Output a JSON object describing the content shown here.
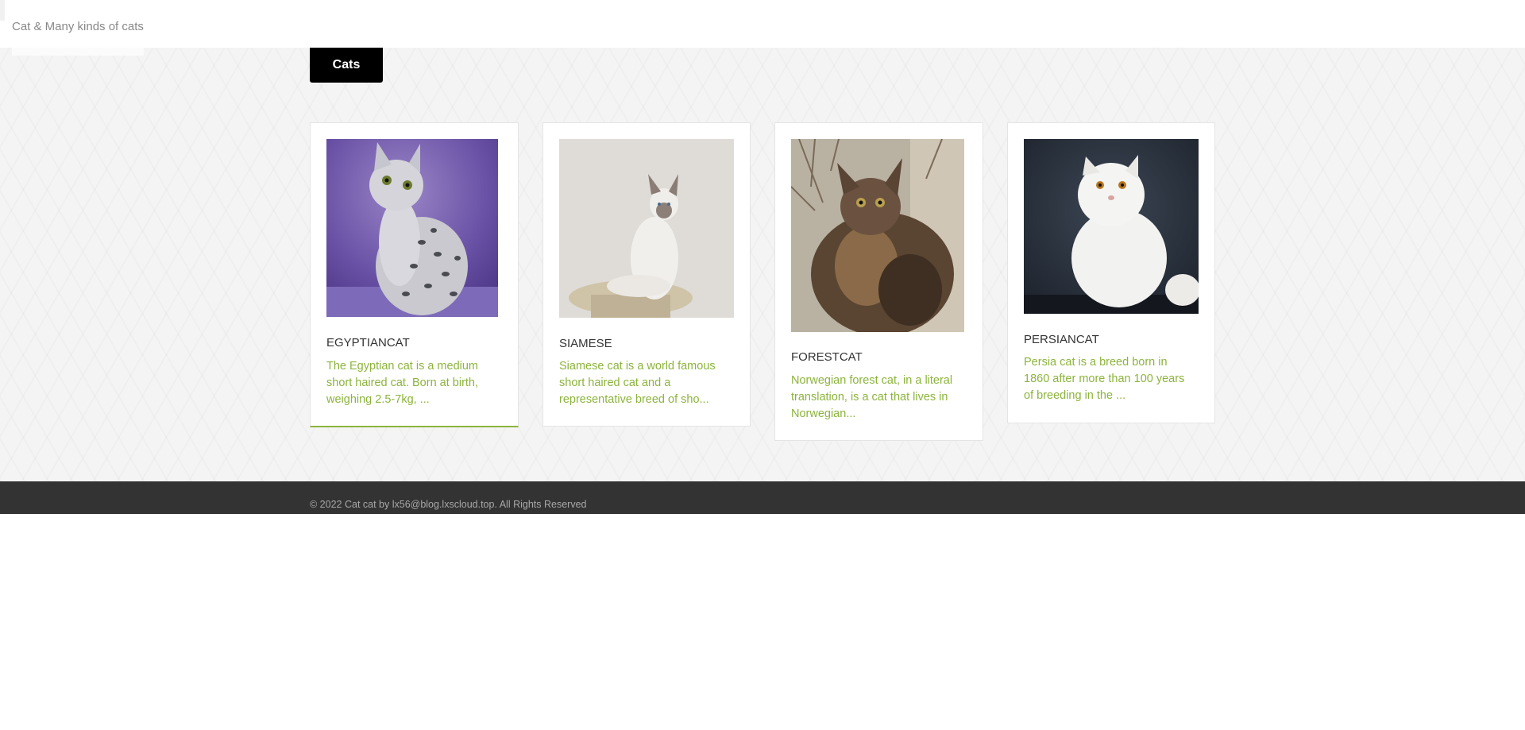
{
  "header": {
    "site_title": "Cat & Many kinds of cats"
  },
  "nav": {
    "tab_label": "Cats"
  },
  "cards": [
    {
      "title": "EGYPTIANCAT",
      "description": "The Egyptian cat is a medium short haired cat. Born at birth, weighing 2.5-7kg, ...",
      "image_icon": "egyptian-cat-photo"
    },
    {
      "title": "SIAMESE",
      "description": "Siamese cat is a world famous short haired cat and a representative breed of sho...",
      "image_icon": "siamese-cat-photo"
    },
    {
      "title": "FORESTCAT",
      "description": "Norwegian forest cat, in a literal translation, is a cat that lives in Norwegian...",
      "image_icon": "forest-cat-photo"
    },
    {
      "title": "PERSIANCAT",
      "description": "Persia cat is a breed born in 1860 after more than 100 years of breeding in the ...",
      "image_icon": "persian-cat-photo"
    }
  ],
  "footer": {
    "copyright": "© 2022 Cat cat by lx56@blog.lxscloud.top. All Rights Reserved"
  },
  "colors": {
    "accent": "#8cb43c",
    "tab_background": "#000000",
    "footer_background": "#333333",
    "page_background": "#f4f4f4"
  }
}
